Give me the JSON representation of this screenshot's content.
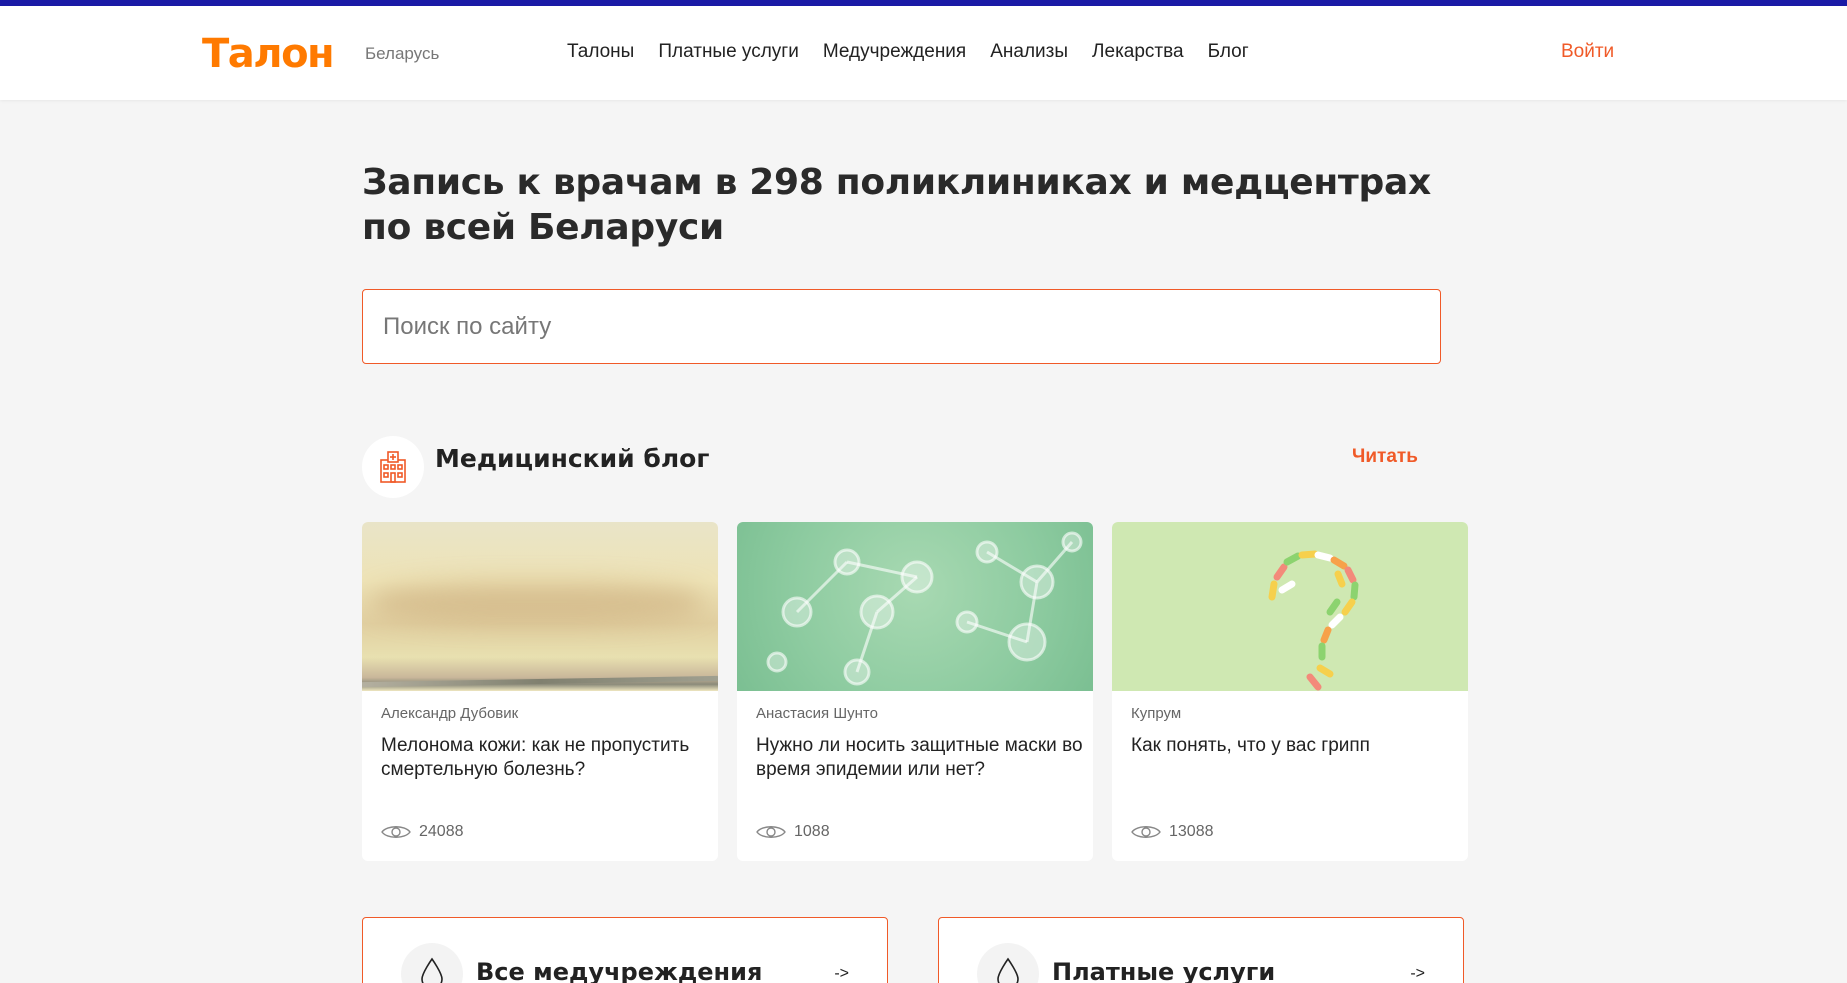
{
  "header": {
    "logo": "Талон",
    "region": "Беларусь",
    "nav": [
      "Талоны",
      "Платные услуги",
      "Медучреждения",
      "Анализы",
      "Лекарства",
      "Блог"
    ],
    "login": "Войти"
  },
  "hero": {
    "title": "Запись к врачам в 298 поликлиниках и медцентрах по всей Беларуси",
    "search_placeholder": "Поиск по сайту"
  },
  "blog": {
    "title": "Медицинский блог",
    "read_link": "Читать",
    "cards": [
      {
        "author": "Александр Дубовик",
        "title": "Мелонома кожи: как не пропустить смертельную болезнь?",
        "views": "24088"
      },
      {
        "author": "Анастасия Шунто",
        "title": "Нужно ли носить защитные маски во время эпидемии или нет?",
        "views": "1088"
      },
      {
        "author": "Купрум",
        "title": "Как понять, что у вас грипп",
        "views": "13088"
      }
    ]
  },
  "tiles": [
    {
      "label": "Все медучреждения",
      "arrow": "->"
    },
    {
      "label": "Платные услуги",
      "arrow": "->"
    }
  ],
  "colors": {
    "accent": "#f05a28",
    "logo": "#ff7a00",
    "top_bar": "#1a1aa6"
  },
  "icons": {
    "blog": "hospital-icon",
    "views": "eye-icon",
    "tiles": "drop-icon"
  }
}
